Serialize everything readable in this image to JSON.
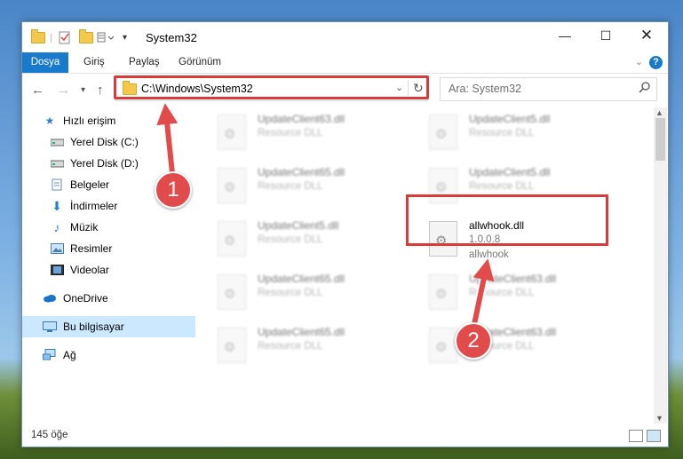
{
  "window": {
    "title": "System32"
  },
  "ribbon": {
    "tabs": [
      "Dosya",
      "Giriş",
      "Paylaş",
      "Görünüm"
    ],
    "help": "?"
  },
  "nav": {
    "address": "C:\\Windows\\System32",
    "search_placeholder": "Ara: System32"
  },
  "sidebar": {
    "items": [
      {
        "label": "Hızlı erişim",
        "icon": "star-icon"
      },
      {
        "label": "Yerel Disk (C:)",
        "icon": "drive-icon"
      },
      {
        "label": "Yerel Disk (D:)",
        "icon": "drive-icon"
      },
      {
        "label": "Belgeler",
        "icon": "documents-icon"
      },
      {
        "label": "İndirmeler",
        "icon": "download-icon"
      },
      {
        "label": "Müzik",
        "icon": "music-icon"
      },
      {
        "label": "Resimler",
        "icon": "pictures-icon"
      },
      {
        "label": "Videolar",
        "icon": "video-icon"
      },
      {
        "label": "OneDrive",
        "icon": "cloud-icon"
      },
      {
        "label": "Bu bilgisayar",
        "icon": "computer-icon"
      },
      {
        "label": "Ağ",
        "icon": "network-icon"
      }
    ]
  },
  "files": [
    {
      "name": "UpdateClient63.dll",
      "sub": "Resource DLL"
    },
    {
      "name": "UpdateClient5.dll",
      "sub": "Resource DLL"
    },
    {
      "name": "UpdateClient65.dll",
      "sub": "Resource DLL"
    },
    {
      "name": "UpdateClient5.dll",
      "sub": "Resource DLL"
    },
    {
      "name": "UpdateClient5.dll",
      "sub": "Resource DLL"
    },
    {
      "name": "allwhook.dll",
      "sub": "1.0.0.8",
      "sub2": "allwhook"
    },
    {
      "name": "UpdateClient65.dll",
      "sub": "Resource DLL"
    },
    {
      "name": "UpdateClient63.dll",
      "sub": "Resource DLL"
    },
    {
      "name": "UpdateClient65.dll",
      "sub": "Resource DLL"
    },
    {
      "name": "UpdateClient63.dll",
      "sub": "Resource DLL"
    }
  ],
  "status": {
    "count": "145 öğe"
  },
  "callouts": [
    "1",
    "2"
  ],
  "colors": {
    "accent": "#1979ca",
    "highlight": "#d93a3a",
    "selected": "#cce8ff"
  }
}
